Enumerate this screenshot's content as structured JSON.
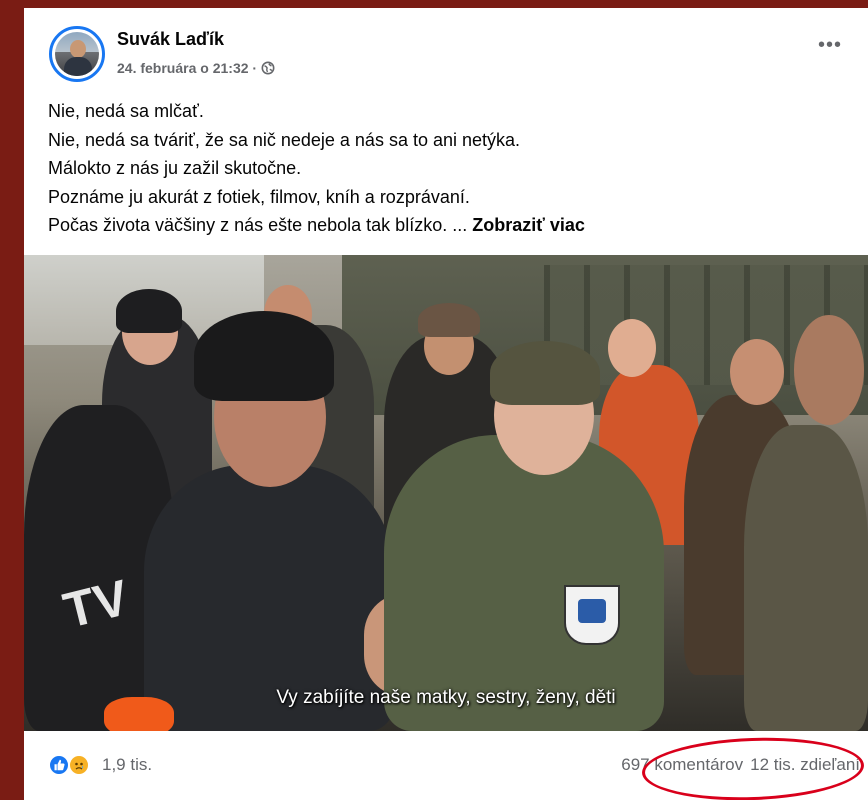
{
  "post": {
    "author": "Suvák Laďík",
    "date": "24. februára o 21:32 ·",
    "more_label": "•••",
    "text_lines": [
      "Nie, nedá sa mlčať.",
      "Nie, nedá sa tváriť, že sa nič nedeje a nás sa to ani netýka.",
      "Málokto z nás ju zažil skutočne.",
      "Poznáme ju akurát z fotiek, filmov, kníh a rozprávaní.",
      "Počas života väčšiny z nás ešte nebola tak blízko. ... "
    ],
    "see_more": "Zobraziť viac"
  },
  "video": {
    "subtitle": "Vy zabíjíte naše matky, sestry, ženy, děti",
    "tv_text": "TV"
  },
  "footer": {
    "reaction_count": "1,9 tis.",
    "comments": "697 komentárov",
    "shares": "12 tis. zdieľaní"
  },
  "colors": {
    "background": "#7a1c14",
    "accent": "#1877f2",
    "highlight": "#d9001b"
  }
}
